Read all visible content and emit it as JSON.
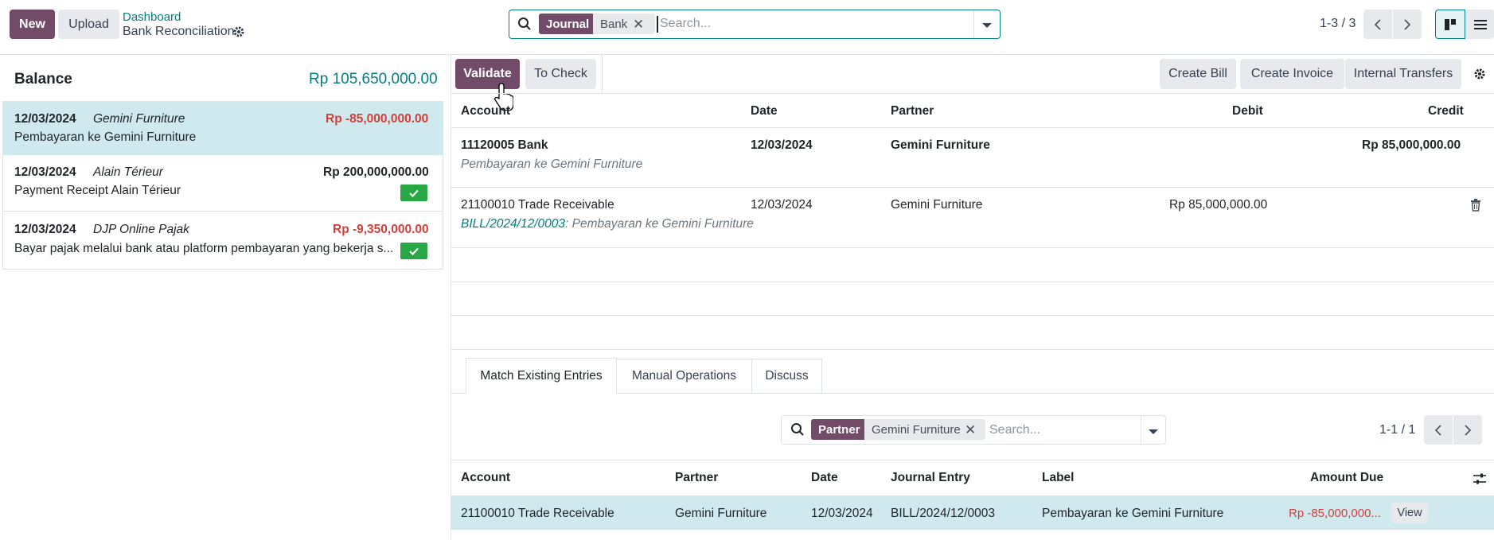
{
  "control_panel": {
    "new_label": "New",
    "upload_label": "Upload",
    "breadcrumb_parent": "Dashboard",
    "breadcrumb_current": "Bank Reconciliation",
    "search": {
      "facet_label": "Journal",
      "facet_value": "Bank",
      "placeholder": "Search..."
    },
    "pager": "1-3 / 3"
  },
  "left_panel": {
    "balance_label": "Balance",
    "balance_value": "Rp 105,650,000.00",
    "transactions": [
      {
        "date": "12/03/2024",
        "partner": "Gemini Furniture",
        "amount": "Rp -85,000,000.00",
        "label": "Pembayaran ke Gemini Furniture",
        "selected": true
      },
      {
        "date": "12/03/2024",
        "partner": "Alain Térieur",
        "amount": "Rp 200,000,000.00",
        "label": "Payment Receipt Alain Térieur",
        "reconciled": true
      },
      {
        "date": "12/03/2024",
        "partner": "DJP Online Pajak",
        "amount": "Rp -9,350,000.00",
        "label": "Bayar pajak melalui bank atau platform pembayaran yang bekerja s...",
        "reconciled": true
      }
    ]
  },
  "toolbar": {
    "validate_label": "Validate",
    "to_check_label": "To Check",
    "create_bill_label": "Create Bill",
    "create_invoice_label": "Create Invoice",
    "internal_transfers_label": "Internal Transfers"
  },
  "lines_table": {
    "headers": {
      "account": "Account",
      "date": "Date",
      "partner": "Partner",
      "debit": "Debit",
      "credit": "Credit"
    },
    "rows": [
      {
        "account": "11120005 Bank",
        "date": "12/03/2024",
        "partner": "Gemini Furniture",
        "debit": "",
        "credit": "Rp 85,000,000.00",
        "sub_label": "Pembayaran ke Gemini Furniture"
      },
      {
        "account": "21100010 Trade Receivable",
        "date": "12/03/2024",
        "partner": "Gemini Furniture",
        "debit": "Rp 85,000,000.00",
        "credit": "",
        "sub_ref": "BILL/2024/12/0003",
        "sub_label": ": Pembayaran ke Gemini Furniture"
      }
    ]
  },
  "tabs": [
    "Match Existing Entries",
    "Manual Operations",
    "Discuss"
  ],
  "match_panel": {
    "search": {
      "facet_label": "Partner",
      "facet_value": "Gemini Furniture",
      "placeholder": "Search..."
    },
    "pager": "1-1 / 1",
    "headers": {
      "account": "Account",
      "partner": "Partner",
      "date": "Date",
      "journal_entry": "Journal Entry",
      "label": "Label",
      "amount_due": "Amount Due"
    },
    "rows": [
      {
        "account": "21100010 Trade Receivable",
        "partner": "Gemini Furniture",
        "date": "12/03/2024",
        "journal_entry": "BILL/2024/12/0003",
        "label": "Pembayaran ke Gemini Furniture",
        "amount_due": "Rp -85,000,000...",
        "view_label": "View"
      }
    ]
  },
  "colors": {
    "brand": "#714b67",
    "accent": "#017e84",
    "danger": "#d23f3a",
    "selected_row": "#cfe9ee",
    "success": "#28a745"
  }
}
